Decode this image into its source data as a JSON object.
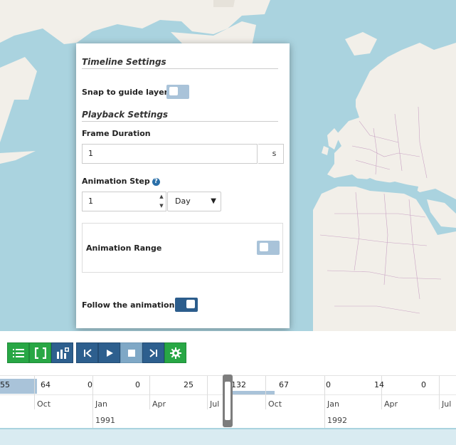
{
  "panel": {
    "timeline_title": "Timeline Settings",
    "snap_label": "Snap to guide layer",
    "snap_toggle": false,
    "playback_title": "Playback Settings",
    "frame_duration_label": "Frame Duration",
    "frame_duration_value": "1",
    "frame_duration_unit": "s",
    "animation_step_label": "Animation Step",
    "animation_step_value": "1",
    "animation_step_unit": "Day",
    "animation_range_label": "Animation Range",
    "animation_range_toggle": false,
    "follow_label": "Follow the animation",
    "follow_toggle": true,
    "help_glyph": "?"
  },
  "toolbar": {
    "buttons": [
      {
        "name": "list-icon",
        "style": "green"
      },
      {
        "name": "range-brackets-icon",
        "style": "green"
      },
      {
        "name": "layers-chart-icon",
        "style": "blue"
      },
      {
        "name": "step-backward-icon",
        "style": "blue"
      },
      {
        "name": "play-icon",
        "style": "blue"
      },
      {
        "name": "stop-icon",
        "style": "light"
      },
      {
        "name": "step-forward-icon",
        "style": "blue"
      },
      {
        "name": "gear-icon",
        "style": "green"
      }
    ]
  },
  "timeline": {
    "counts": [
      "55",
      "64",
      "0",
      "0",
      "25",
      "132",
      "67",
      "0",
      "14",
      "0"
    ],
    "months": [
      "Oct",
      "Jan",
      "Apr",
      "Jul",
      "Oct",
      "Jan",
      "Apr",
      "Jul"
    ],
    "years": [
      "1991",
      "1992"
    ]
  },
  "colors": {
    "water": "#aad3df",
    "land": "#f2efe9",
    "green": "#28a745",
    "blue": "#2d5f8e",
    "toggle_on": "#2c5d8c",
    "toggle_off": "#a9c3d9",
    "histogram_bar": "#a9c3d9"
  }
}
